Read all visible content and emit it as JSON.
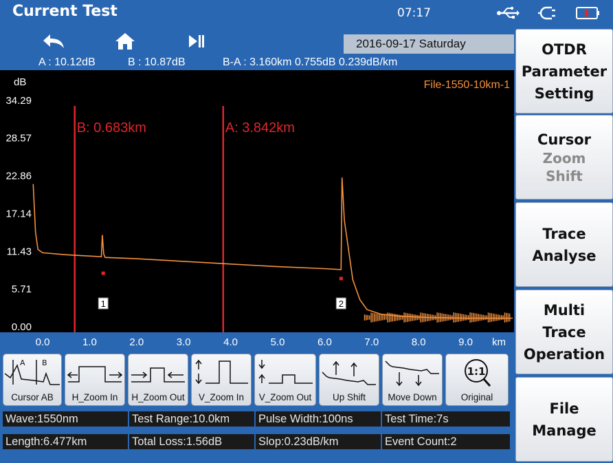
{
  "title": "Current Test",
  "clock": "07:17",
  "date": "2016-09-17 Saturday",
  "measure": {
    "a": "A : 10.12dB",
    "b": "B : 10.87dB",
    "ba": "B-A : 3.160km  0.755dB  0.239dB/km"
  },
  "chart_data": {
    "type": "line",
    "title": "File-1550-10km-1",
    "ylabel": "dB",
    "xlabel": "km",
    "x_ticks": [
      "0.0",
      "1.0",
      "2.0",
      "3.0",
      "4.0",
      "5.0",
      "6.0",
      "7.0",
      "8.0",
      "9.0"
    ],
    "y_ticks": [
      "34.29",
      "28.57",
      "22.86",
      "17.14",
      "11.43",
      "5.71",
      "0.00"
    ],
    "y_ticks_visible": [
      "34.29",
      "28.57",
      "22.86",
      "17.14",
      "11.43",
      "5.71",
      "0.00"
    ],
    "xlim": [
      -0.2,
      10.0
    ],
    "ylim": [
      0,
      37.7
    ],
    "cursor_a": {
      "label": "A: 3.842km",
      "x": 3.842
    },
    "cursor_b": {
      "label": "B: 0.683km",
      "x": 0.683
    },
    "events": [
      {
        "id": "1",
        "x": 1.29,
        "y": 8.0
      },
      {
        "id": "2",
        "x": 6.35,
        "y": 7.2
      }
    ],
    "trace": [
      [
        -0.2,
        21.5
      ],
      [
        -0.15,
        14.2
      ],
      [
        -0.1,
        11.6
      ],
      [
        0.0,
        11.1
      ],
      [
        0.5,
        10.8
      ],
      [
        1.0,
        10.6
      ],
      [
        1.25,
        10.5
      ],
      [
        1.27,
        13.8
      ],
      [
        1.3,
        10.9
      ],
      [
        1.33,
        10.4
      ],
      [
        2.0,
        10.2
      ],
      [
        3.0,
        9.8
      ],
      [
        4.0,
        9.4
      ],
      [
        5.0,
        9.0
      ],
      [
        6.0,
        8.7
      ],
      [
        6.35,
        8.55
      ],
      [
        6.37,
        22.5
      ],
      [
        6.42,
        16.0
      ],
      [
        6.5,
        12.0
      ],
      [
        6.6,
        7.0
      ],
      [
        6.75,
        4.0
      ],
      [
        6.9,
        2.5
      ],
      [
        7.2,
        1.8
      ],
      [
        7.6,
        1.5
      ],
      [
        8.2,
        1.3
      ],
      [
        9.0,
        1.2
      ],
      [
        10.0,
        1.2
      ]
    ],
    "trace_color": "#f5923e",
    "cursor_color": "#e0262b"
  },
  "tools": [
    {
      "label": "Cursor AB",
      "icon": "cursor-ab-icon"
    },
    {
      "label": "H_Zoom In",
      "icon": "h-zoom-in-icon"
    },
    {
      "label": "H_Zoom Out",
      "icon": "h-zoom-out-icon"
    },
    {
      "label": "V_Zoom In",
      "icon": "v-zoom-in-icon"
    },
    {
      "label": "V_Zoom Out",
      "icon": "v-zoom-out-icon"
    },
    {
      "label": "Up Shift",
      "icon": "up-shift-icon"
    },
    {
      "label": "Move Down",
      "icon": "move-down-icon"
    },
    {
      "label": "Original",
      "icon": "original-icon",
      "glyph": "1:1"
    }
  ],
  "status": {
    "wave": "Wave:1550nm",
    "range": "Test Range:10.0km",
    "pulse": "Pulse Width:100ns",
    "time": "Test Time:7s",
    "length": "Length:6.477km",
    "loss": "Total Loss:1.56dB",
    "slop": "Slop:0.23dB/km",
    "events": "Event Count:2"
  },
  "menu": {
    "otdr": [
      "OTDR",
      "Parameter",
      "Setting"
    ],
    "cursor": {
      "active": "Cursor",
      "zoom": "Zoom",
      "shift": "Shift"
    },
    "trace": [
      "Trace",
      "Analyse"
    ],
    "multi": [
      "Multi",
      "Trace",
      "Operation"
    ],
    "file": [
      "File",
      "Manage"
    ]
  }
}
